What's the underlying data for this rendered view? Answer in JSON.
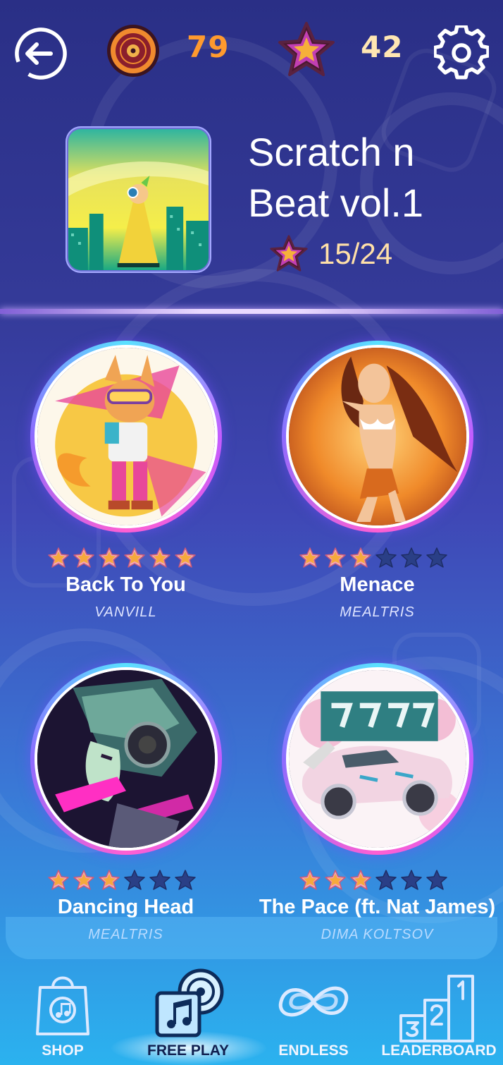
{
  "top_bar": {
    "coins": "79",
    "stars": "42"
  },
  "album": {
    "title_line1": "Scratch n",
    "title_line2": "Beat vol.1",
    "progress": "15/24"
  },
  "songs": [
    {
      "title": "Back To You",
      "artist": "VANVILL",
      "stars_earned": 6,
      "stars_total": 6,
      "art": "fox-character-art"
    },
    {
      "title": "Menace",
      "artist": "MEALTRIS",
      "stars_earned": 3,
      "stars_total": 6,
      "art": "dancer-art"
    },
    {
      "title": "Dancing Head",
      "artist": "MEALTRIS",
      "stars_earned": 3,
      "stars_total": 6,
      "art": "cyborg-art"
    },
    {
      "title": "The Pace (ft. Nat James)",
      "artist": "DIMA KOLTSOV",
      "stars_earned": 3,
      "stars_total": 6,
      "art": "sports-car-art"
    }
  ],
  "nav": {
    "shop": "SHOP",
    "free_play": "FREE PLAY",
    "endless": "ENDLESS",
    "leaderboard": "LEADERBOARD",
    "active": "free_play"
  },
  "colors": {
    "coin_text": "#ff9a2e",
    "star_text": "#ffe6b3",
    "star_filled": "#f6a93c",
    "star_empty": "#2a3f86"
  }
}
